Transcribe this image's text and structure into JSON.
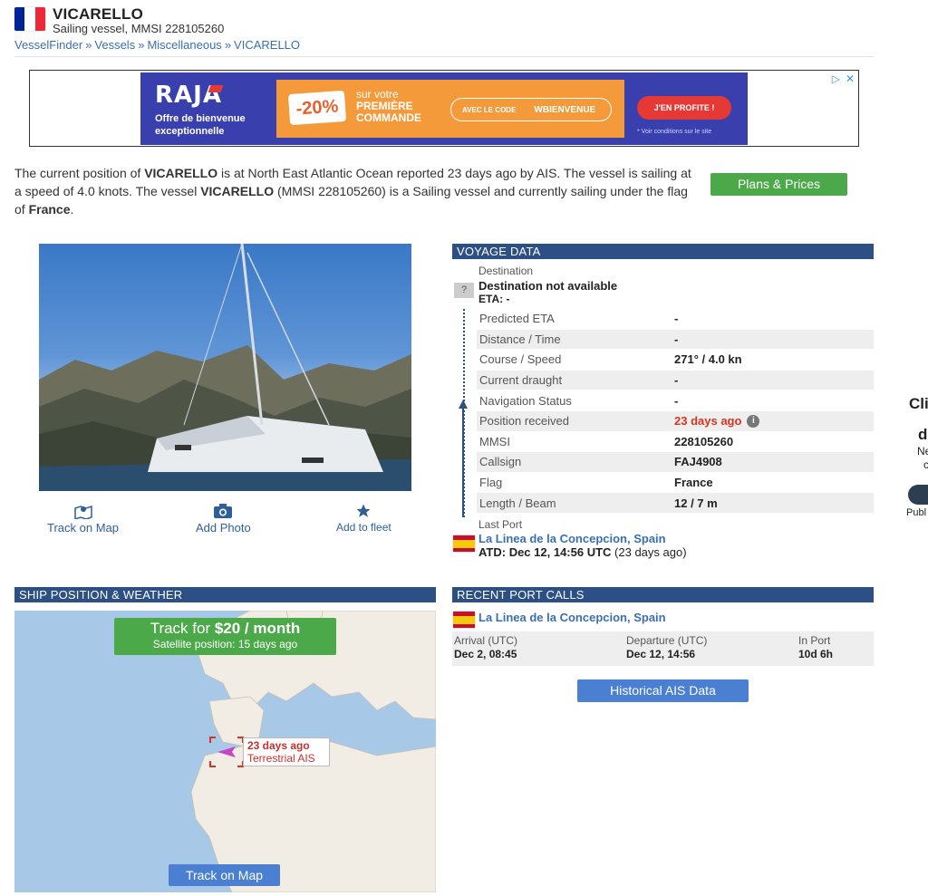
{
  "header": {
    "title": "VICARELLO",
    "subtitle": "Sailing vessel, MMSI 228105260",
    "breadcrumb": [
      "VesselFinder",
      "Vessels",
      "Miscellaneous",
      "VICARELLO"
    ],
    "breadcrumb_sep": "»",
    "flag_colors": [
      "#002395",
      "#ffffff",
      "#ed2939"
    ]
  },
  "ad": {
    "brand": "RAJA",
    "welcome_line1": "Offre de bienvenue",
    "welcome_line2": "exceptionnelle",
    "discount": "-20%",
    "promo_line1": "sur votre",
    "promo_line2": "PREMIÈRE",
    "promo_line3": "COMMANDE",
    "code_label": "AVEC LE CODE",
    "code_value": "WBIENVENUE",
    "cta": "J'EN PROFITE !",
    "conditions": "* Voir conditions sur le site",
    "choices_icons": [
      "adchoices-icon",
      "close-icon"
    ]
  },
  "intro": {
    "p1": "The current position of ",
    "name1": "VICARELLO",
    "p2": " is at North East Atlantic Ocean reported 23 days ago by AIS. The vessel is sailing at a speed of 4.0 knots. The vessel ",
    "name2": "VICARELLO",
    "p3": " (MMSI 228105260) is a Sailing vessel and currently sailing under the flag of ",
    "flag": "France",
    "p4": "."
  },
  "plans_button": "Plans & Prices",
  "photo_actions": [
    {
      "label": "Track on Map",
      "icon": "map-pin-icon"
    },
    {
      "label": "Add Photo",
      "icon": "camera-icon"
    },
    {
      "label": "Add to fleet",
      "icon": "star-icon"
    }
  ],
  "voyage": {
    "heading": "VOYAGE DATA",
    "destination_label": "Destination",
    "destination_unknown": "?",
    "destination": "Destination not available",
    "eta": "ETA: -",
    "rows": [
      {
        "k": "Predicted ETA",
        "v": "-"
      },
      {
        "k": "Distance / Time",
        "v": "-"
      },
      {
        "k": "Course / Speed",
        "v": "271° / 4.0 kn"
      },
      {
        "k": "Current draught",
        "v": "-"
      },
      {
        "k": "Navigation Status",
        "v": "-"
      },
      {
        "k": "Position received",
        "v": "23 days ago"
      },
      {
        "k": "MMSI",
        "v": "228105260"
      },
      {
        "k": "Callsign",
        "v": "FAJ4908"
      },
      {
        "k": "Flag",
        "v": "France"
      },
      {
        "k": "Length / Beam",
        "v": "12 / 7 m"
      }
    ],
    "last_port_label": "Last Port",
    "last_port": "La Linea de la Concepcion, Spain",
    "atd": "ATD: Dec 12, 14:56 UTC",
    "atd_ago": "(23 days ago)",
    "info_icon": "i",
    "accent_red": "#d9341f"
  },
  "ship_position": {
    "heading": "SHIP POSITION & WEATHER",
    "track_prefix": "Track for ",
    "track_price": "$20 / month",
    "satellite": "Satellite position: 15 days ago",
    "pin_ago": "23 days ago",
    "pin_source": "Terrestrial AIS",
    "map_button": "Track on Map"
  },
  "recent_calls": {
    "heading": "RECENT PORT CALLS",
    "port": "La Linea de la Concepcion, Spain",
    "arrival_label": "Arrival (UTC)",
    "arrival": "Dec 2, 08:45",
    "departure_label": "Departure (UTC)",
    "departure": "Dec 12, 14:56",
    "inport_label": "In Port",
    "inport": "10d 6h",
    "historical_button": "Historical AIS Data"
  },
  "edge": {
    "t1": "Cli",
    "t2": "d",
    "t3": "Ne",
    "t4": "c",
    "t5": "Publ"
  }
}
